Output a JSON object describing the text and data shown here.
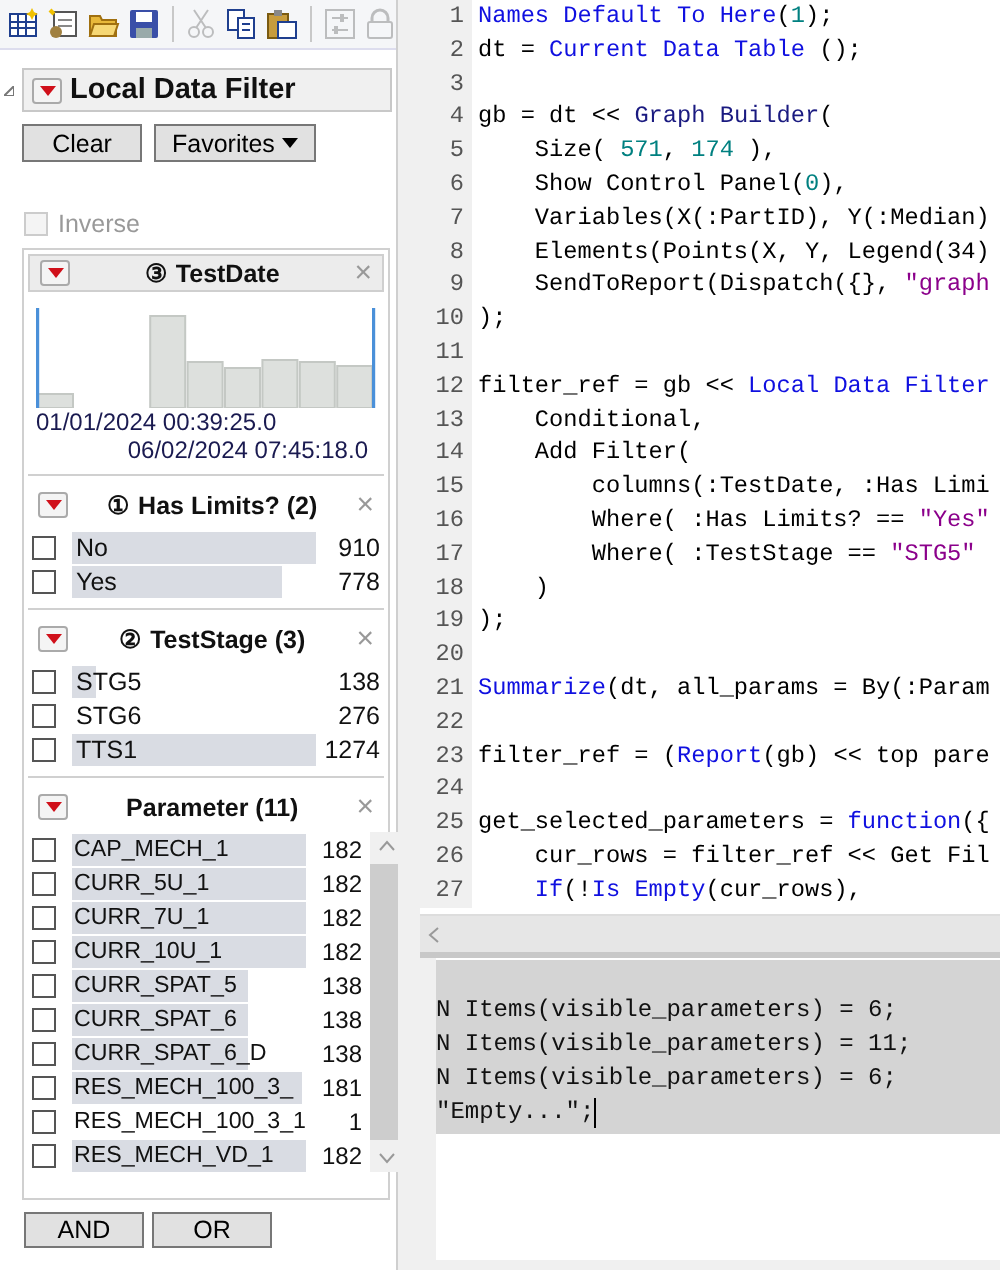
{
  "toolbar": [
    {
      "kind": "new-table",
      "disabled": false
    },
    {
      "kind": "new-script",
      "disabled": false
    },
    {
      "kind": "open",
      "disabled": false
    },
    {
      "kind": "save",
      "disabled": false
    },
    {
      "kind": "separator"
    },
    {
      "kind": "cut",
      "disabled": true
    },
    {
      "kind": "copy",
      "disabled": false
    },
    {
      "kind": "paste",
      "disabled": false
    },
    {
      "kind": "separator"
    },
    {
      "kind": "settings",
      "disabled": true
    },
    {
      "kind": "lock",
      "disabled": true
    }
  ],
  "filter": {
    "title": "Local Data Filter",
    "clear_button": "Clear",
    "favorites_button": "Favorites",
    "inverse": {
      "label": "Inverse",
      "checked": false,
      "disabled": true
    },
    "sections": [
      {
        "kind": "histogram",
        "title": "③ TestDate",
        "close": "×",
        "start": "01/01/2024 00:39:25.0",
        "end": "06/02/2024 07:45:18.0"
      },
      {
        "kind": "list",
        "title": "① Has Limits? (2)",
        "close": "×",
        "scrollbar": false,
        "items": [
          {
            "label": "No",
            "count": "910",
            "level": 1,
            "checked": false
          },
          {
            "label": "Yes",
            "count": "778",
            "level": 0.86,
            "checked": false
          }
        ]
      },
      {
        "kind": "list",
        "title": "② TestStage (3)",
        "close": "×",
        "scrollbar": false,
        "items": [
          {
            "label": "STG5",
            "count": "138",
            "level": 0.1,
            "checked": false
          },
          {
            "label": "STG6",
            "count": "276",
            "level": 0,
            "checked": false
          },
          {
            "label": "TTS1",
            "count": "1274",
            "level": 1,
            "checked": false
          }
        ]
      },
      {
        "kind": "list",
        "title": "Parameter (11)",
        "close": "×",
        "scrollbar": true,
        "items": [
          {
            "label": "CAP_MECH_1",
            "count": "182",
            "level": 1,
            "checked": false
          },
          {
            "label": "CURR_5U_1",
            "count": "182",
            "level": 1,
            "checked": false
          },
          {
            "label": "CURR_7U_1",
            "count": "182",
            "level": 1,
            "checked": false
          },
          {
            "label": "CURR_10U_1",
            "count": "182",
            "level": 1,
            "checked": false
          },
          {
            "label": "CURR_SPAT_5",
            "count": "138",
            "level": 0.75,
            "checked": false
          },
          {
            "label": "CURR_SPAT_6",
            "count": "138",
            "level": 0.75,
            "checked": false
          },
          {
            "label": "CURR_SPAT_6_D",
            "count": "138",
            "level": 0.75,
            "checked": false
          },
          {
            "label": "RES_MECH_100_3_",
            "count": "181",
            "level": 0.98,
            "checked": false
          },
          {
            "label": "RES_MECH_100_3_1",
            "count": "1",
            "level": 0,
            "checked": false
          },
          {
            "label": "RES_MECH_VD_1",
            "count": "182",
            "level": 1,
            "checked": false
          }
        ]
      }
    ],
    "and_button": "AND",
    "or_button": "OR"
  },
  "editor": {
    "lines": [
      {
        "number": "1",
        "tokens": [
          {
            "kind": "function",
            "text": "Names Default To Here"
          },
          {
            "kind": "plain",
            "text": "("
          },
          {
            "kind": "number",
            "text": "1"
          },
          {
            "kind": "plain",
            "text": ");"
          }
        ]
      },
      {
        "number": "2",
        "tokens": [
          {
            "kind": "plain",
            "text": "dt = "
          },
          {
            "kind": "function",
            "text": "Current Data Table"
          },
          {
            "kind": "plain",
            "text": " ();"
          }
        ]
      },
      {
        "number": "3"
      },
      {
        "number": "4",
        "tokens": [
          {
            "kind": "plain",
            "text": "gb = dt << "
          },
          {
            "kind": "message",
            "text": "Graph Builder"
          },
          {
            "kind": "plain",
            "text": "("
          }
        ]
      },
      {
        "number": "5",
        "tokens": [
          {
            "kind": "plain",
            "text": "    Size( "
          },
          {
            "kind": "number",
            "text": "571"
          },
          {
            "kind": "plain",
            "text": ", "
          },
          {
            "kind": "number",
            "text": "174"
          },
          {
            "kind": "plain",
            "text": " ),"
          }
        ]
      },
      {
        "number": "6",
        "tokens": [
          {
            "kind": "plain",
            "text": "    Show Control Panel("
          },
          {
            "kind": "number",
            "text": "0"
          },
          {
            "kind": "plain",
            "text": "),"
          }
        ]
      },
      {
        "number": "7",
        "tokens": [
          {
            "kind": "plain",
            "text": "    Variables(X(:PartID), Y(:Median)"
          }
        ]
      },
      {
        "number": "8",
        "tokens": [
          {
            "kind": "plain",
            "text": "    Elements(Points(X, Y, Legend(34)"
          }
        ]
      },
      {
        "number": "9",
        "tokens": [
          {
            "kind": "plain",
            "text": "    SendToReport(Dispatch({}, "
          },
          {
            "kind": "string",
            "text": "\"graph"
          }
        ]
      },
      {
        "number": "10",
        "tokens": [
          {
            "kind": "plain",
            "text": ");"
          }
        ]
      },
      {
        "number": "11"
      },
      {
        "number": "12",
        "tokens": [
          {
            "kind": "plain",
            "text": "filter_ref = gb << "
          },
          {
            "kind": "function",
            "text": "Local Data Filter"
          }
        ]
      },
      {
        "number": "13",
        "tokens": [
          {
            "kind": "plain",
            "text": "    Conditional,"
          }
        ]
      },
      {
        "number": "14",
        "tokens": [
          {
            "kind": "plain",
            "text": "    Add Filter("
          }
        ]
      },
      {
        "number": "15",
        "tokens": [
          {
            "kind": "plain",
            "text": "        columns(:TestDate, :Has Limi"
          }
        ]
      },
      {
        "number": "16",
        "tokens": [
          {
            "kind": "plain",
            "text": "        Where( :Has Limits? == "
          },
          {
            "kind": "string",
            "text": "\"Yes\""
          }
        ]
      },
      {
        "number": "17",
        "tokens": [
          {
            "kind": "plain",
            "text": "        Where( :TestStage == "
          },
          {
            "kind": "string",
            "text": "\"STG5\""
          }
        ]
      },
      {
        "number": "18",
        "tokens": [
          {
            "kind": "plain",
            "text": "    )"
          }
        ]
      },
      {
        "number": "19",
        "tokens": [
          {
            "kind": "plain",
            "text": ");"
          }
        ]
      },
      {
        "number": "20"
      },
      {
        "number": "21",
        "tokens": [
          {
            "kind": "function",
            "text": "Summarize"
          },
          {
            "kind": "plain",
            "text": "(dt, all_params = By(:Param"
          }
        ]
      },
      {
        "number": "22"
      },
      {
        "number": "23",
        "tokens": [
          {
            "kind": "plain",
            "text": "filter_ref = ("
          },
          {
            "kind": "function",
            "text": "Report"
          },
          {
            "kind": "plain",
            "text": "(gb) << top pare"
          }
        ]
      },
      {
        "number": "24"
      },
      {
        "number": "25",
        "tokens": [
          {
            "kind": "plain",
            "text": "get_selected_parameters = "
          },
          {
            "kind": "function",
            "text": "function"
          },
          {
            "kind": "plain",
            "text": "({"
          }
        ]
      },
      {
        "number": "26",
        "tokens": [
          {
            "kind": "plain",
            "text": "    cur_rows = filter_ref << Get Fil"
          }
        ]
      },
      {
        "number": "27",
        "tokens": [
          {
            "kind": "function",
            "text": "    If"
          },
          {
            "kind": "plain",
            "text": "(!"
          },
          {
            "kind": "function",
            "text": "Is Empty"
          },
          {
            "kind": "plain",
            "text": "(cur_rows),"
          }
        ]
      }
    ]
  },
  "output": {
    "selected": true,
    "lines": [
      "N Items(visible_parameters) = 6;",
      "N Items(visible_parameters) = 11;",
      "N Items(visible_parameters) = 6;",
      "\"Empty...\";"
    ]
  }
}
